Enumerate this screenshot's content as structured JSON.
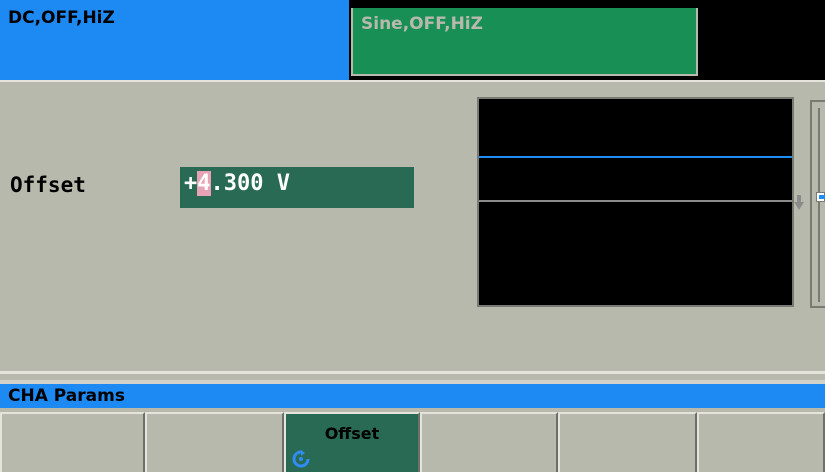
{
  "channel_tabs": {
    "cha_status": "DC,OFF,HiZ",
    "chb_status": "Sine,OFF,HiZ"
  },
  "parameter": {
    "label": "Offset",
    "sign": "+",
    "cursor_digit": "4",
    "rest": ".300 V"
  },
  "menu": {
    "title": "CHA Params",
    "softkeys": [
      "",
      "",
      "Offset",
      "",
      "",
      ""
    ],
    "active_index": 2
  },
  "icons": {
    "softkey_3": "knob-rotate-icon"
  },
  "colors": {
    "cha_tab": "#1d89f2",
    "chb_tab": "#188f55",
    "field_bg": "#296a54",
    "cursor_bg": "#e8a2b5",
    "wave": "#1e8ef5",
    "background": "#b8b9ad"
  }
}
